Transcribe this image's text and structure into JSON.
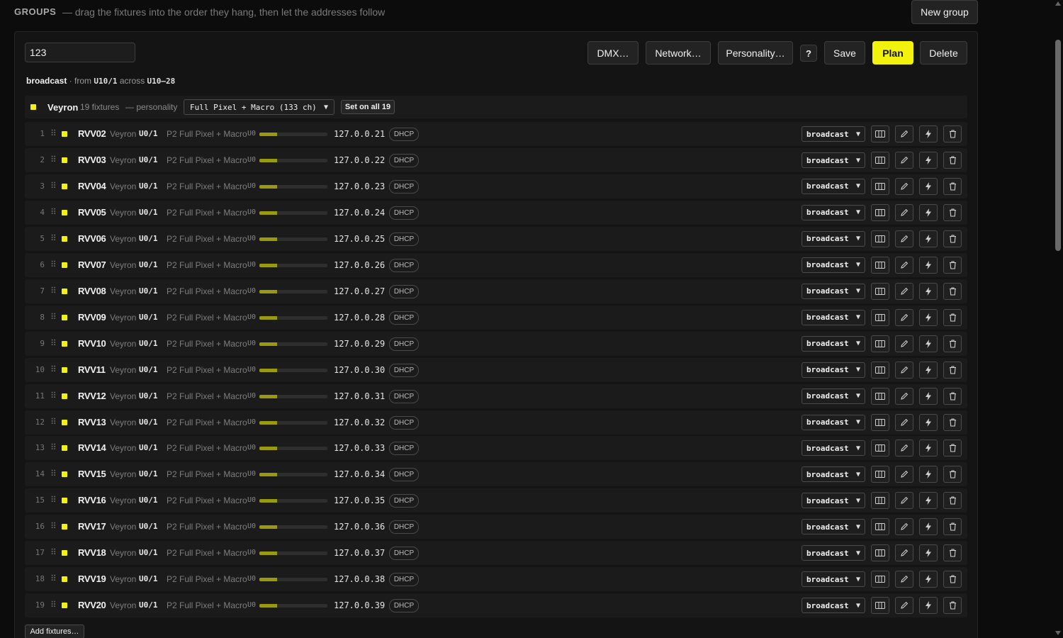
{
  "header": {
    "title": "GROUPS",
    "subtitle": "— drag the fixtures into the order they hang, then let the addresses follow",
    "new_group_label": "New group"
  },
  "group": {
    "name_value": "123",
    "toolbar": {
      "dmx_label": "DMX…",
      "network_label": "Network…",
      "personality_label": "Personality…",
      "help_label": "?",
      "save_label": "Save",
      "plan_label": "Plan",
      "delete_label": "Delete"
    },
    "summary": {
      "mode": "broadcast",
      "from_text": "· from",
      "from_addr": "U10/1",
      "across_text": "across",
      "across_range": "U10–28"
    },
    "head": {
      "name": "Veyron",
      "count": "19 fixtures",
      "personality_label": "— personality",
      "personality_value": "Full Pixel + Macro (133 ch)",
      "set_all_label": "Set on all 19"
    },
    "add_fixtures_label": "Add fixtures…"
  },
  "colors": {
    "accent": "#f2f20d",
    "bar_fill": "#9a9a10"
  },
  "icons": [
    "columns-icon",
    "pencil-icon",
    "bolt-icon",
    "trash-icon"
  ],
  "fixtures": [
    {
      "index": "1",
      "id": "RVV02",
      "model": "Veyron",
      "address": "U0/1",
      "personality": "P2 Full Pixel + Macro",
      "universe": "U0",
      "usage": 0.26,
      "ip": "127.0.0.21",
      "ip_mode": "DHCP",
      "mode": "broadcast"
    },
    {
      "index": "2",
      "id": "RVV03",
      "model": "Veyron",
      "address": "U0/1",
      "personality": "P2 Full Pixel + Macro",
      "universe": "U0",
      "usage": 0.26,
      "ip": "127.0.0.22",
      "ip_mode": "DHCP",
      "mode": "broadcast"
    },
    {
      "index": "3",
      "id": "RVV04",
      "model": "Veyron",
      "address": "U0/1",
      "personality": "P2 Full Pixel + Macro",
      "universe": "U0",
      "usage": 0.26,
      "ip": "127.0.0.23",
      "ip_mode": "DHCP",
      "mode": "broadcast"
    },
    {
      "index": "4",
      "id": "RVV05",
      "model": "Veyron",
      "address": "U0/1",
      "personality": "P2 Full Pixel + Macro",
      "universe": "U0",
      "usage": 0.26,
      "ip": "127.0.0.24",
      "ip_mode": "DHCP",
      "mode": "broadcast"
    },
    {
      "index": "5",
      "id": "RVV06",
      "model": "Veyron",
      "address": "U0/1",
      "personality": "P2 Full Pixel + Macro",
      "universe": "U0",
      "usage": 0.26,
      "ip": "127.0.0.25",
      "ip_mode": "DHCP",
      "mode": "broadcast"
    },
    {
      "index": "6",
      "id": "RVV07",
      "model": "Veyron",
      "address": "U0/1",
      "personality": "P2 Full Pixel + Macro",
      "universe": "U0",
      "usage": 0.26,
      "ip": "127.0.0.26",
      "ip_mode": "DHCP",
      "mode": "broadcast"
    },
    {
      "index": "7",
      "id": "RVV08",
      "model": "Veyron",
      "address": "U0/1",
      "personality": "P2 Full Pixel + Macro",
      "universe": "U0",
      "usage": 0.26,
      "ip": "127.0.0.27",
      "ip_mode": "DHCP",
      "mode": "broadcast"
    },
    {
      "index": "8",
      "id": "RVV09",
      "model": "Veyron",
      "address": "U0/1",
      "personality": "P2 Full Pixel + Macro",
      "universe": "U0",
      "usage": 0.26,
      "ip": "127.0.0.28",
      "ip_mode": "DHCP",
      "mode": "broadcast"
    },
    {
      "index": "9",
      "id": "RVV10",
      "model": "Veyron",
      "address": "U0/1",
      "personality": "P2 Full Pixel + Macro",
      "universe": "U0",
      "usage": 0.26,
      "ip": "127.0.0.29",
      "ip_mode": "DHCP",
      "mode": "broadcast"
    },
    {
      "index": "10",
      "id": "RVV11",
      "model": "Veyron",
      "address": "U0/1",
      "personality": "P2 Full Pixel + Macro",
      "universe": "U0",
      "usage": 0.26,
      "ip": "127.0.0.30",
      "ip_mode": "DHCP",
      "mode": "broadcast"
    },
    {
      "index": "11",
      "id": "RVV12",
      "model": "Veyron",
      "address": "U0/1",
      "personality": "P2 Full Pixel + Macro",
      "universe": "U0",
      "usage": 0.26,
      "ip": "127.0.0.31",
      "ip_mode": "DHCP",
      "mode": "broadcast"
    },
    {
      "index": "12",
      "id": "RVV13",
      "model": "Veyron",
      "address": "U0/1",
      "personality": "P2 Full Pixel + Macro",
      "universe": "U0",
      "usage": 0.26,
      "ip": "127.0.0.32",
      "ip_mode": "DHCP",
      "mode": "broadcast"
    },
    {
      "index": "13",
      "id": "RVV14",
      "model": "Veyron",
      "address": "U0/1",
      "personality": "P2 Full Pixel + Macro",
      "universe": "U0",
      "usage": 0.26,
      "ip": "127.0.0.33",
      "ip_mode": "DHCP",
      "mode": "broadcast"
    },
    {
      "index": "14",
      "id": "RVV15",
      "model": "Veyron",
      "address": "U0/1",
      "personality": "P2 Full Pixel + Macro",
      "universe": "U0",
      "usage": 0.26,
      "ip": "127.0.0.34",
      "ip_mode": "DHCP",
      "mode": "broadcast"
    },
    {
      "index": "15",
      "id": "RVV16",
      "model": "Veyron",
      "address": "U0/1",
      "personality": "P2 Full Pixel + Macro",
      "universe": "U0",
      "usage": 0.26,
      "ip": "127.0.0.35",
      "ip_mode": "DHCP",
      "mode": "broadcast"
    },
    {
      "index": "16",
      "id": "RVV17",
      "model": "Veyron",
      "address": "U0/1",
      "personality": "P2 Full Pixel + Macro",
      "universe": "U0",
      "usage": 0.26,
      "ip": "127.0.0.36",
      "ip_mode": "DHCP",
      "mode": "broadcast"
    },
    {
      "index": "17",
      "id": "RVV18",
      "model": "Veyron",
      "address": "U0/1",
      "personality": "P2 Full Pixel + Macro",
      "universe": "U0",
      "usage": 0.26,
      "ip": "127.0.0.37",
      "ip_mode": "DHCP",
      "mode": "broadcast"
    },
    {
      "index": "18",
      "id": "RVV19",
      "model": "Veyron",
      "address": "U0/1",
      "personality": "P2 Full Pixel + Macro",
      "universe": "U0",
      "usage": 0.26,
      "ip": "127.0.0.38",
      "ip_mode": "DHCP",
      "mode": "broadcast"
    },
    {
      "index": "19",
      "id": "RVV20",
      "model": "Veyron",
      "address": "U0/1",
      "personality": "P2 Full Pixel + Macro",
      "universe": "U0",
      "usage": 0.26,
      "ip": "127.0.0.39",
      "ip_mode": "DHCP",
      "mode": "broadcast"
    }
  ]
}
